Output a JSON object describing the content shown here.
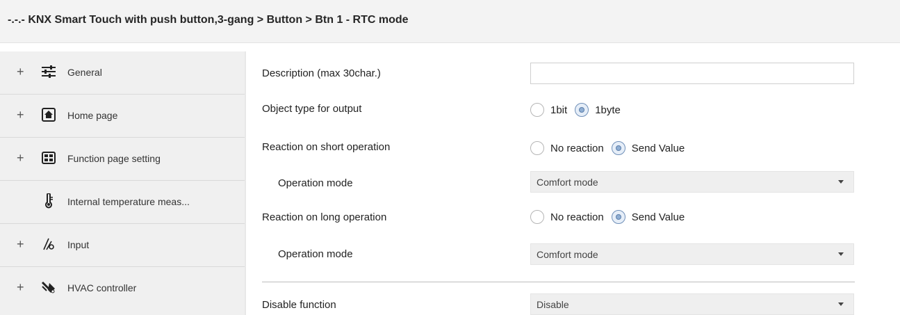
{
  "title": "-.-.- KNX Smart Touch with push button,3-gang > Button > Btn 1 - RTC mode",
  "sidebar": {
    "items": [
      {
        "label": "General",
        "icon": "sliders-icon",
        "expandable": "+"
      },
      {
        "label": "Home page",
        "icon": "home-icon",
        "expandable": "+"
      },
      {
        "label": "Function page setting",
        "icon": "grid-icon",
        "expandable": "+"
      },
      {
        "label": "Internal temperature meas...",
        "icon": "thermometer-icon",
        "expandable": ""
      },
      {
        "label": "Input",
        "icon": "input-icon",
        "expandable": "+"
      },
      {
        "label": "HVAC controller",
        "icon": "hvac-icon",
        "expandable": "+"
      }
    ]
  },
  "params": {
    "description": {
      "label": "Description (max 30char.)",
      "value": ""
    },
    "object_type": {
      "label": "Object type for output",
      "options": [
        "1bit",
        "1byte"
      ],
      "selected": "1byte"
    },
    "short_op": {
      "label": "Reaction on short operation",
      "options": [
        "No reaction",
        "Send Value"
      ],
      "selected": "Send Value"
    },
    "short_mode": {
      "label": "Operation mode",
      "value": "Comfort mode"
    },
    "long_op": {
      "label": "Reaction on long operation",
      "options": [
        "No reaction",
        "Send Value"
      ],
      "selected": "Send Value"
    },
    "long_mode": {
      "label": "Operation mode",
      "value": "Comfort mode"
    },
    "disable": {
      "label": "Disable function",
      "value": "Disable"
    }
  },
  "colors": {
    "radio_checked": "#8faed3",
    "sidebar_bg": "#f0f0f0",
    "title_bg": "#f3f3f3"
  }
}
